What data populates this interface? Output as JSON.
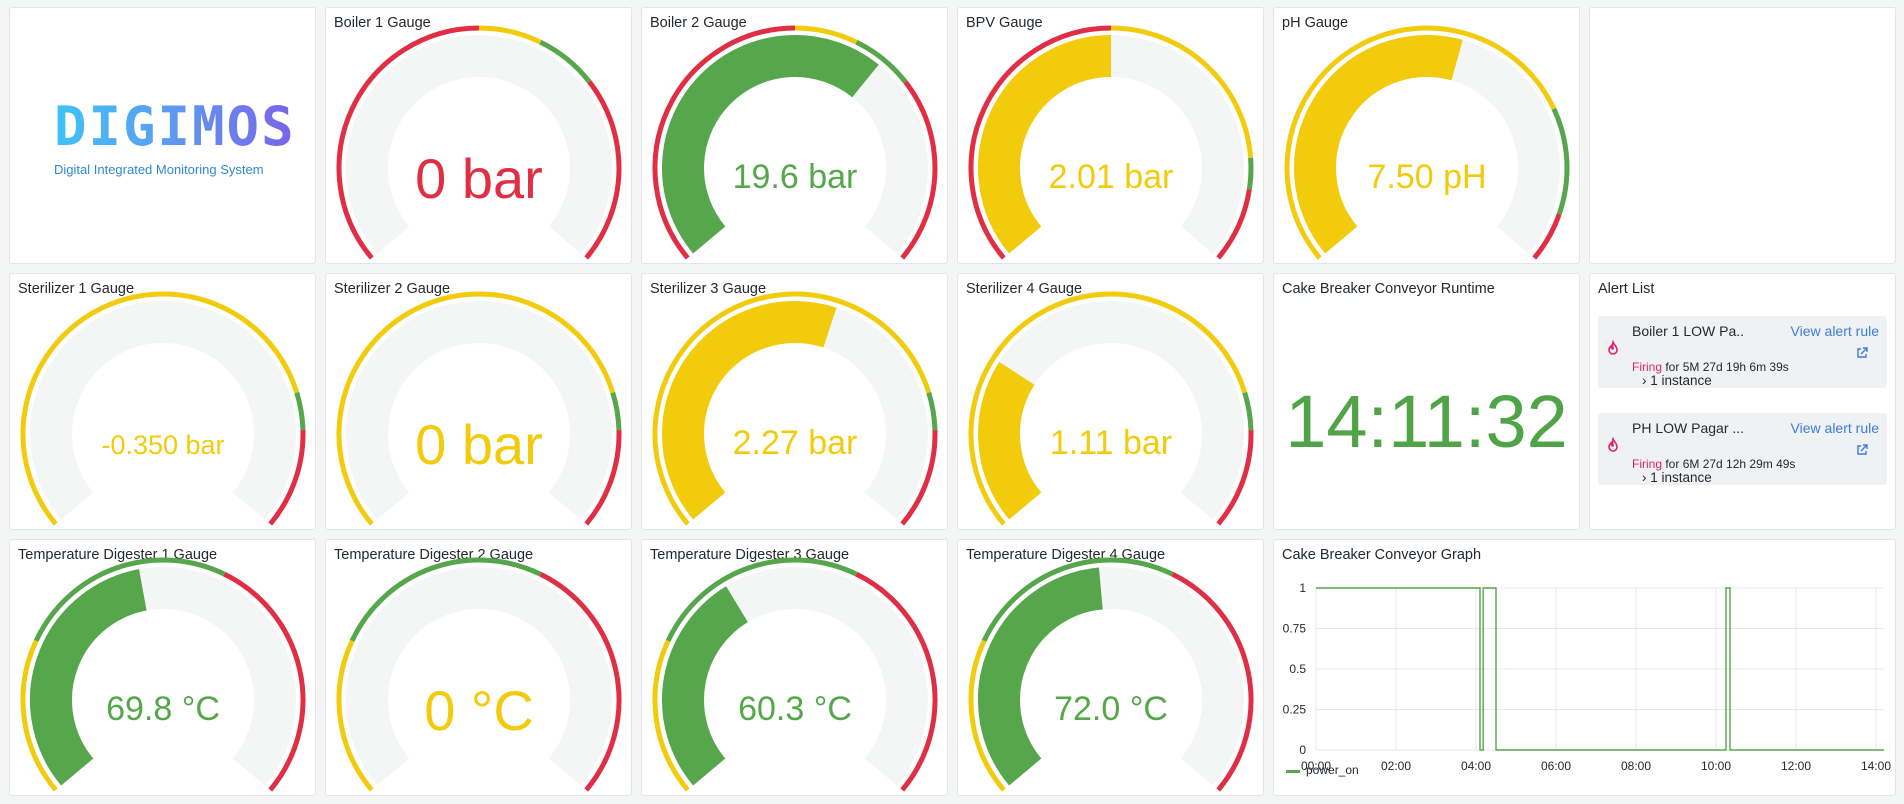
{
  "colors": {
    "red": "#e02f44",
    "yellow": "#f2cc0c",
    "green": "#56a64b",
    "track": "#f4f5f5"
  },
  "logo": {
    "word": "DIGIMOS",
    "subtitle": "Digital Integrated Monitoring System"
  },
  "gauges": [
    {
      "id": "boiler-1",
      "title": "Boiler 1 Gauge",
      "value_text": "0 bar",
      "fraction": 0.0,
      "value_color": "#e02f44",
      "size": "large",
      "thresholds": [
        [
          "#e02f44",
          0.5
        ],
        [
          "#f2cc0c",
          0.6
        ],
        [
          "#56a64b",
          0.7
        ],
        [
          "#e02f44",
          1.0
        ]
      ]
    },
    {
      "id": "boiler-2",
      "title": "Boiler 2 Gauge",
      "value_text": "19.6 bar",
      "fraction": 0.65,
      "value_color": "#56a64b",
      "size": "medium",
      "thresholds": [
        [
          "#e02f44",
          0.5
        ],
        [
          "#f2cc0c",
          0.6
        ],
        [
          "#56a64b",
          0.7
        ],
        [
          "#e02f44",
          1.0
        ]
      ]
    },
    {
      "id": "bpv",
      "title": "BPV Gauge",
      "value_text": "2.01 bar",
      "fraction": 0.5,
      "value_color": "#f2cc0c",
      "size": "medium",
      "thresholds": [
        [
          "#e02f44",
          0.5
        ],
        [
          "#f2cc0c",
          0.83
        ],
        [
          "#56a64b",
          0.88
        ],
        [
          "#e02f44",
          1.0
        ]
      ]
    },
    {
      "id": "ph",
      "title": "pH Gauge",
      "value_text": "7.50 pH",
      "fraction": 0.56,
      "value_color": "#f2cc0c",
      "size": "medium",
      "thresholds": [
        [
          "#f2cc0c",
          0.75
        ],
        [
          "#56a64b",
          0.92
        ],
        [
          "#e02f44",
          1.0
        ]
      ]
    },
    {
      "id": "sterilizer-1",
      "title": "Sterilizer 1 Gauge",
      "value_text": "-0.350 bar",
      "fraction": 0.0,
      "value_color": "#f2cc0c",
      "size": "small",
      "thresholds": [
        [
          "#f2cc0c",
          0.78
        ],
        [
          "#56a64b",
          0.84
        ],
        [
          "#e02f44",
          1.0
        ]
      ]
    },
    {
      "id": "sterilizer-2",
      "title": "Sterilizer 2 Gauge",
      "value_text": "0 bar",
      "fraction": 0.0,
      "value_color": "#f2cc0c",
      "size": "large",
      "thresholds": [
        [
          "#f2cc0c",
          0.78
        ],
        [
          "#56a64b",
          0.84
        ],
        [
          "#e02f44",
          1.0
        ]
      ]
    },
    {
      "id": "sterilizer-3",
      "title": "Sterilizer 3 Gauge",
      "value_text": "2.27 bar",
      "fraction": 0.57,
      "value_color": "#f2cc0c",
      "size": "medium",
      "thresholds": [
        [
          "#f2cc0c",
          0.78
        ],
        [
          "#56a64b",
          0.84
        ],
        [
          "#e02f44",
          1.0
        ]
      ]
    },
    {
      "id": "sterilizer-4",
      "title": "Sterilizer 4 Gauge",
      "value_text": "1.11 bar",
      "fraction": 0.28,
      "value_color": "#f2cc0c",
      "size": "medium",
      "thresholds": [
        [
          "#f2cc0c",
          0.78
        ],
        [
          "#56a64b",
          0.84
        ],
        [
          "#e02f44",
          1.0
        ]
      ]
    },
    {
      "id": "temp-digester-1",
      "title": "Temperature Digester 1 Gauge",
      "value_text": "69.8 °C",
      "fraction": 0.46,
      "value_color": "#56a64b",
      "size": "medium",
      "thresholds": [
        [
          "#f2cc0c",
          0.25
        ],
        [
          "#56a64b",
          0.6
        ],
        [
          "#e02f44",
          1.0
        ]
      ]
    },
    {
      "id": "temp-digester-2",
      "title": "Temperature Digester 2 Gauge",
      "value_text": "0 °C",
      "fraction": 0.0,
      "value_color": "#f2cc0c",
      "size": "large",
      "thresholds": [
        [
          "#f2cc0c",
          0.25
        ],
        [
          "#56a64b",
          0.6
        ],
        [
          "#e02f44",
          1.0
        ]
      ]
    },
    {
      "id": "temp-digester-3",
      "title": "Temperature Digester 3 Gauge",
      "value_text": "60.3 °C",
      "fraction": 0.38,
      "value_color": "#56a64b",
      "size": "medium",
      "thresholds": [
        [
          "#f2cc0c",
          0.25
        ],
        [
          "#56a64b",
          0.6
        ],
        [
          "#e02f44",
          1.0
        ]
      ]
    },
    {
      "id": "temp-digester-4",
      "title": "Temperature Digester 4 Gauge",
      "value_text": "72.0 °C",
      "fraction": 0.48,
      "value_color": "#56a64b",
      "size": "medium",
      "thresholds": [
        [
          "#f2cc0c",
          0.25
        ],
        [
          "#56a64b",
          0.6
        ],
        [
          "#e02f44",
          1.0
        ]
      ]
    }
  ],
  "runtime": {
    "title": "Cake Breaker Conveyor Runtime",
    "value": "14:11:32"
  },
  "alert_list": {
    "title": "Alert List",
    "items": [
      {
        "name": "Boiler 1 LOW Pa...",
        "link": "View alert rule",
        "state": "Firing",
        "duration": " for 5M 27d 19h 6m 39s",
        "instances": "› 1 instance"
      },
      {
        "name": "PH LOW Pagar ...",
        "link": "View alert rule",
        "state": "Firing",
        "duration": " for 6M 27d 12h 29m 49s",
        "instances": "› 1 instance"
      }
    ]
  },
  "graph": {
    "title": "Cake Breaker Conveyor Graph",
    "legend": "power_on"
  },
  "chart_data": {
    "type": "line",
    "title": "Cake Breaker Conveyor Graph",
    "xlabel": "",
    "ylabel": "",
    "x_ticks": [
      "00:00",
      "02:00",
      "04:00",
      "06:00",
      "08:00",
      "10:00",
      "12:00",
      "14:00"
    ],
    "y_ticks": [
      "0",
      "0.25",
      "0.5",
      "0.75",
      "1"
    ],
    "xlim": [
      0,
      14.2
    ],
    "ylim": [
      0,
      1
    ],
    "grid": true,
    "legend_position": "bottom-left",
    "series": [
      {
        "name": "power_on",
        "color": "#56a64b",
        "x": [
          0,
          4.1,
          4.1,
          4.18,
          4.18,
          4.5,
          4.5,
          10.25,
          10.25,
          10.35,
          10.35,
          14.2
        ],
        "y": [
          1,
          1,
          0,
          0,
          1,
          1,
          0,
          0,
          1,
          1,
          0,
          0
        ]
      }
    ]
  }
}
